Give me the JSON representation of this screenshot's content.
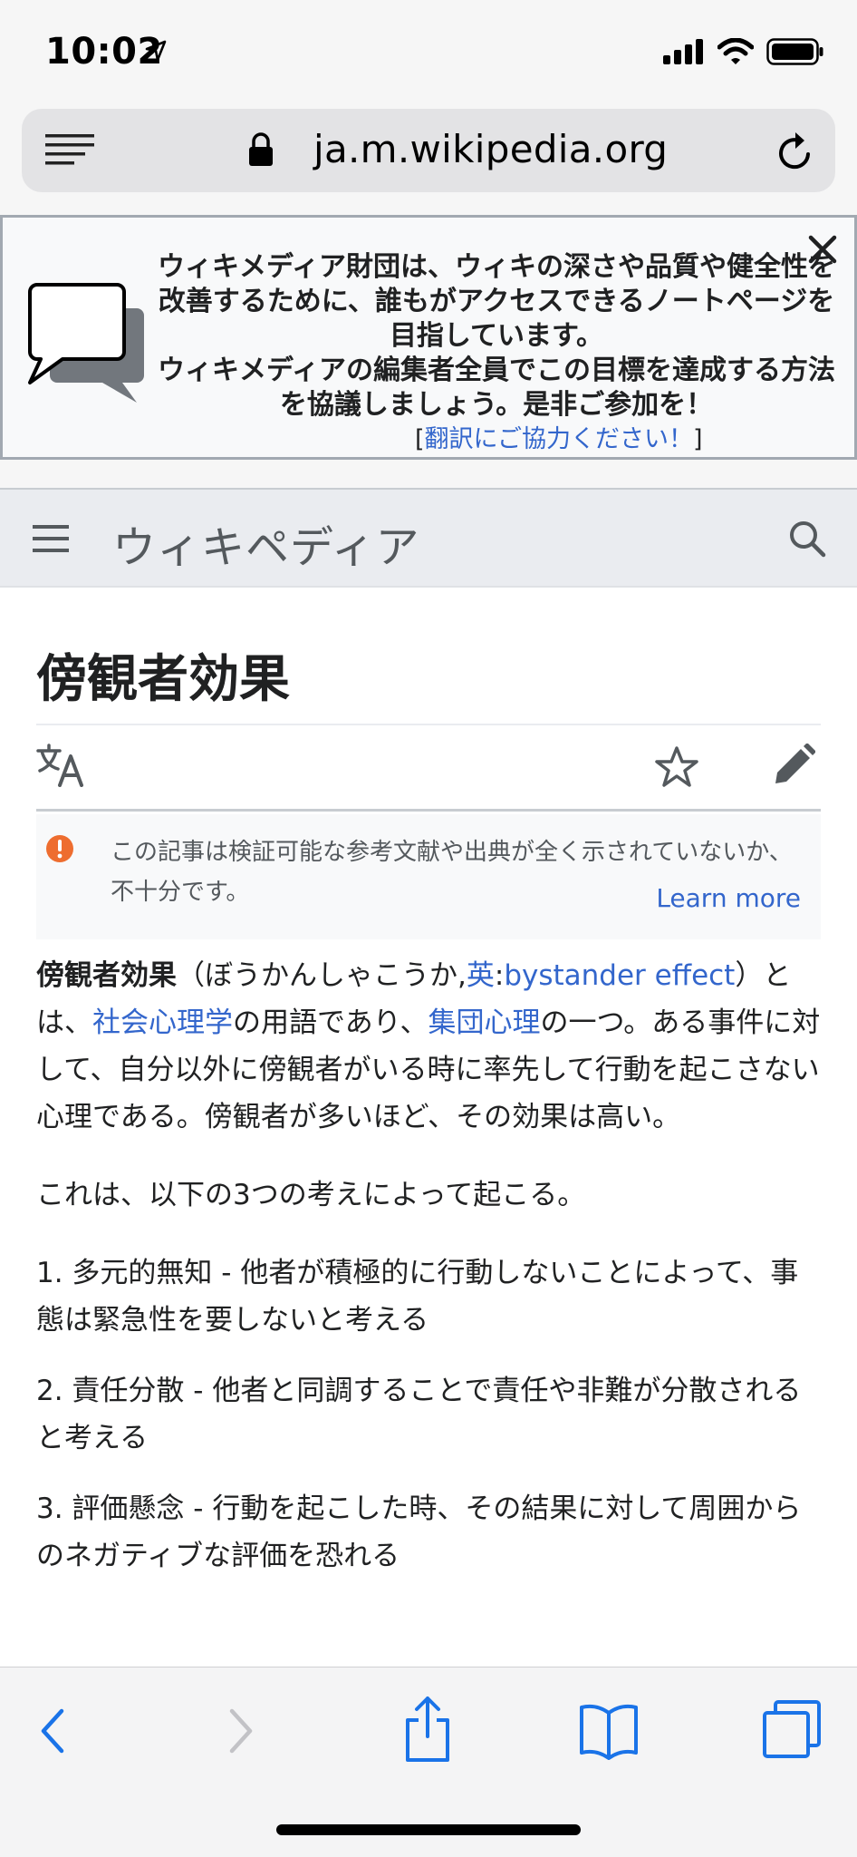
{
  "status_bar": {
    "time": "10:02",
    "icons": [
      "location-arrow-icon",
      "cellular-signal-icon",
      "wifi-icon",
      "battery-icon"
    ]
  },
  "url_bar": {
    "url": "ja.m.wikipedia.org",
    "icons": [
      "reader-view-icon",
      "lock-icon",
      "reload-icon"
    ]
  },
  "banner": {
    "text_line1": "ウィキメディア財団は、ウィキの深さや品質や健全性を改善するために、誰もがアクセスできるノートページを目指しています。",
    "text_line2": "ウィキメディアの編集者全員でこの目標を達成する方法を協議しましょう。是非ご参加を！",
    "translate_open": "[",
    "translate_link": "翻訳にご協力ください！",
    "translate_close": "]"
  },
  "header": {
    "site_title": "ウィキペディア"
  },
  "article": {
    "title": "傍観者効果",
    "notice": {
      "text": "この記事は検証可能な参考文献や出典が全く示されていないか、不十分です。",
      "learn_more": "Learn more",
      "color": "#fc3"
    },
    "intro": {
      "term": "傍観者効果",
      "reading": "（ぼうかんしゃこうか,",
      "lang_link": "英",
      "colon": ":",
      "english_link": "bystander effect",
      "after_english": "）とは、",
      "link_social": "社会心理学",
      "text2": "の用語であり、",
      "link_group": "集団心理",
      "text3": "の一つ。ある事件に対して、自分以外に傍観者がいる時に率先して行動を起こさない心理である。傍観者が多いほど、その効果は高い。"
    },
    "para2": "これは、以下の3つの考えによって起こる。",
    "list": [
      "1. 多元的無知 - 他者が積極的に行動しないことによって、事態は緊急性を要しないと考える",
      "2. 責任分散 - 他者と同調することで責任や非難が分散されると考える",
      "3. 評価懸念 - 行動を起こした時、その結果に対して周囲からのネガティブな評価を恐れる"
    ]
  },
  "colors": {
    "link": "#3366cc",
    "safari_blue": "#1a73e8",
    "notice_icon": "#ee6d2f"
  }
}
